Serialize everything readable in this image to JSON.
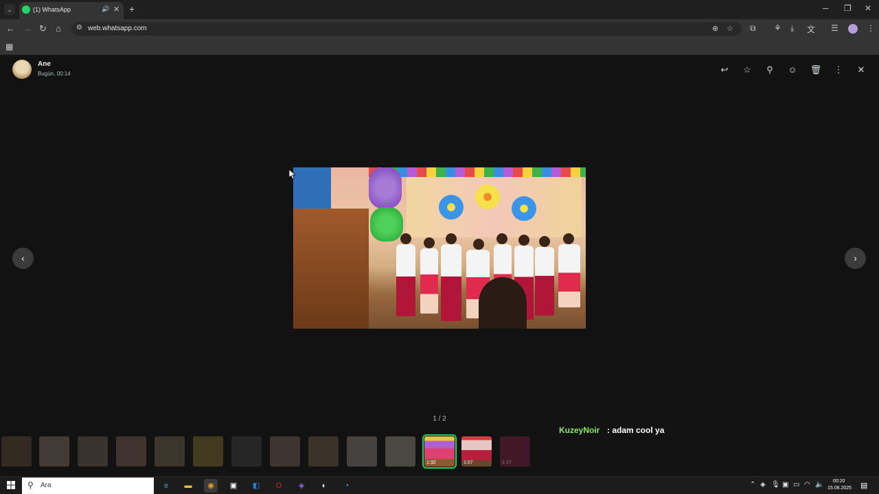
{
  "browser": {
    "tab_title": "(1) WhatsApp",
    "url": "web.whatsapp.com",
    "icons": {
      "tab_audio": "speaker-icon",
      "close": "close-icon",
      "new_tab": "plus-icon",
      "back": "arrow-left-icon",
      "forward": "arrow-right-icon",
      "reload": "reload-icon",
      "home": "home-icon"
    },
    "glyphs": {
      "tab_menu": "⌄",
      "tab_audio": "🔊",
      "tab_close": "✕",
      "new_tab": "+",
      "minimize": "─",
      "restore": "❐",
      "close": "✕",
      "back": "←",
      "forward": "→",
      "reload": "↻",
      "home": "⌂",
      "site_info": "⚙",
      "install": "⊕",
      "bookmark": "☆",
      "extensions": "⧉",
      "performance": "⚘",
      "download": "⤓",
      "translate": "文",
      "reading_list": "☰",
      "menu": "⋮",
      "apps": "▦"
    }
  },
  "viewer": {
    "sender_name": "Ane",
    "sent_time": "Bugün, 00:14",
    "counter": "1 / 2",
    "header_glyphs": {
      "reply": "↩",
      "star": "☆",
      "pin": "⚲",
      "react": "☺",
      "delete": "🗑",
      "menu": "⋮",
      "close": "✕"
    },
    "nav_glyphs": {
      "prev": "‹",
      "next": "›"
    },
    "thumbnails": [
      {
        "duration": ""
      },
      {
        "duration": ""
      },
      {
        "duration": ""
      },
      {
        "duration": ""
      },
      {
        "duration": ""
      },
      {
        "duration": ""
      },
      {
        "duration": ""
      },
      {
        "duration": ""
      },
      {
        "duration": ""
      },
      {
        "duration": ""
      },
      {
        "duration": ""
      },
      {
        "duration": "1:32"
      },
      {
        "duration": "1:07"
      },
      {
        "duration": "1:17"
      }
    ]
  },
  "stream_chat": {
    "user": "KuzeyNoir",
    "message": ": adam cool ya"
  },
  "taskbar": {
    "search_placeholder": "Ara",
    "search_glyph": "⚲",
    "time": "00:20",
    "date": "15.08.2025",
    "tray_glyphs": {
      "chevron": "⌃",
      "discord": "◈",
      "mic": "🎙",
      "camera": "▣",
      "battery": "▭",
      "wifi": "◠",
      "volume": "🔈",
      "notifications": "▤"
    }
  },
  "colors": {
    "accent": "#25d366",
    "chat_user": "#8cea6a",
    "viewer_bg": "#121212"
  }
}
